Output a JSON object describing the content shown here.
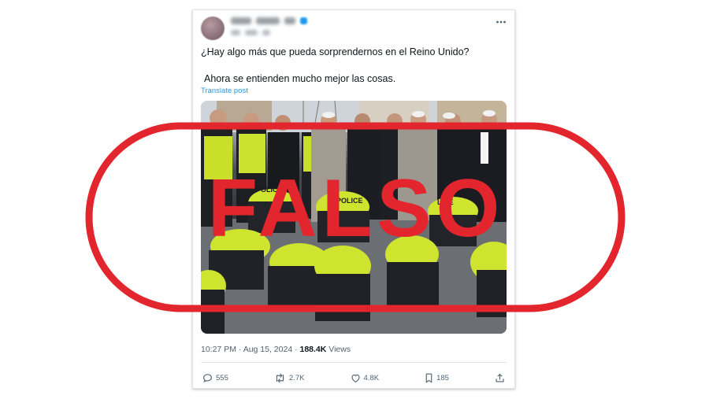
{
  "post": {
    "more_icon": "ellipsis-icon",
    "text_line1": "¿Hay algo más que pueda sorprendernos en el Reino Unido?",
    "text_line2": "Ahora se entienden mucho mejor las cosas.",
    "translate_label": "Translate post",
    "image": {
      "vest_labels": [
        "POLICE",
        "POLICE",
        "LICE"
      ]
    },
    "timestamp": "10:27 PM · Aug 15, 2024 · ",
    "views_count": "188.4K",
    "views_label": " Views",
    "actions": {
      "replies": "555",
      "reposts": "2.7K",
      "likes": "4.8K",
      "bookmarks": "185"
    }
  },
  "overlay": {
    "stamp_text": "FALSO",
    "stamp_color": "#e3262d"
  }
}
